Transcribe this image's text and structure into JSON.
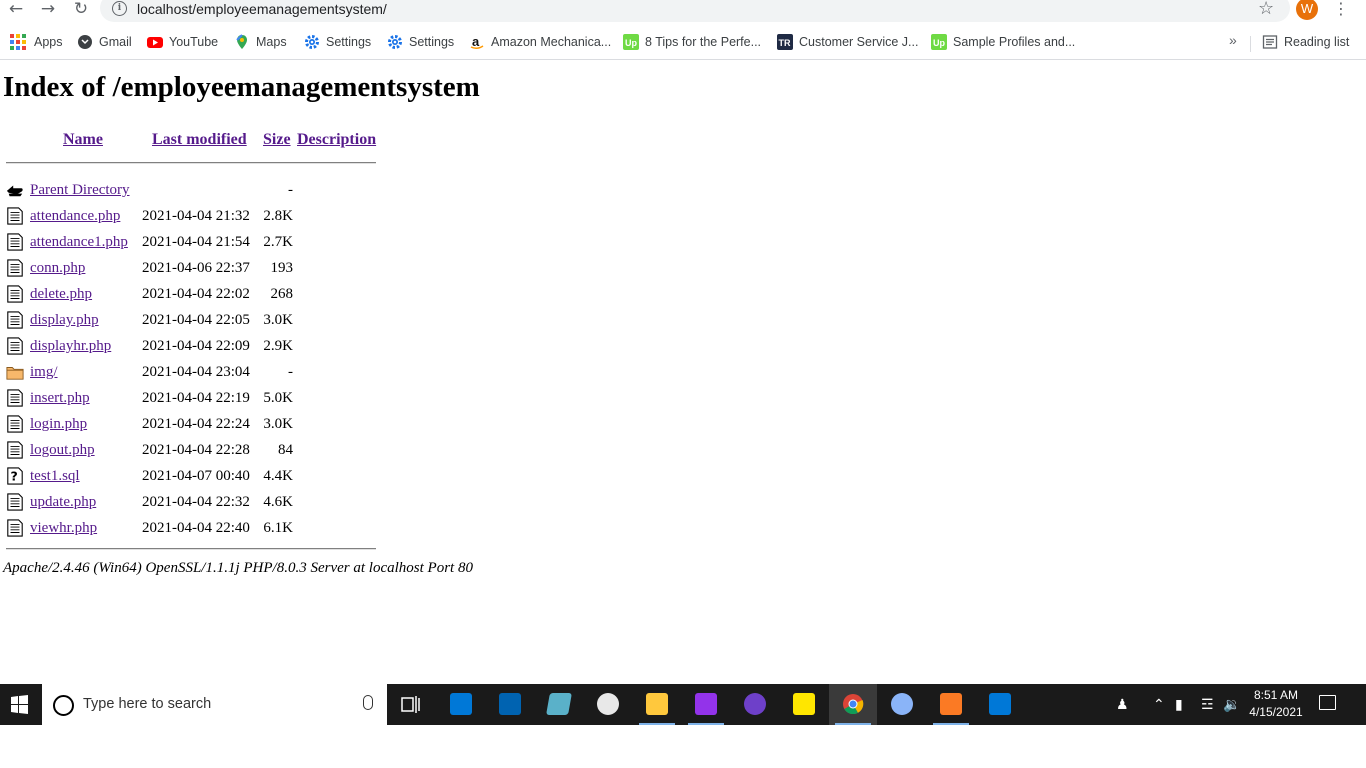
{
  "browser": {
    "url": "localhost/employeemanagementsystem/",
    "avatar_letter": "W",
    "bookmarks": [
      {
        "label": "Apps",
        "icon": "apps-grid-icon"
      },
      {
        "label": "Gmail",
        "icon": "gmail-icon"
      },
      {
        "label": "YouTube",
        "icon": "youtube-icon"
      },
      {
        "label": "Maps",
        "icon": "maps-icon"
      },
      {
        "label": "Settings",
        "icon": "settings-gear-icon"
      },
      {
        "label": "Settings",
        "icon": "settings-gear-icon"
      },
      {
        "label": "Amazon Mechanica...",
        "icon": "amazon-icon"
      },
      {
        "label": "8 Tips for the Perfe...",
        "icon": "upwork-icon"
      },
      {
        "label": "Customer Service J...",
        "icon": "tr-icon"
      },
      {
        "label": "Sample Profiles and...",
        "icon": "upwork-icon"
      }
    ],
    "more_bookmarks": "»",
    "reading_list": "Reading list"
  },
  "page": {
    "title": "Index of /employeemanagementsystem",
    "columns": {
      "name": "Name",
      "modified": "Last modified",
      "size": "Size",
      "description": "Description"
    },
    "parent": {
      "label": "Parent Directory",
      "size": "-"
    },
    "entries": [
      {
        "name": "attendance.php",
        "modified": "2021-04-04 21:32",
        "size": "2.8K",
        "type": "file"
      },
      {
        "name": "attendance1.php",
        "modified": "2021-04-04 21:54",
        "size": "2.7K",
        "type": "file"
      },
      {
        "name": "conn.php",
        "modified": "2021-04-06 22:37",
        "size": "193",
        "type": "file"
      },
      {
        "name": "delete.php",
        "modified": "2021-04-04 22:02",
        "size": "268",
        "type": "file"
      },
      {
        "name": "display.php",
        "modified": "2021-04-04 22:05",
        "size": "3.0K",
        "type": "file"
      },
      {
        "name": "displayhr.php",
        "modified": "2021-04-04 22:09",
        "size": "2.9K",
        "type": "file"
      },
      {
        "name": "img/",
        "modified": "2021-04-04 23:04",
        "size": "-",
        "type": "folder"
      },
      {
        "name": "insert.php",
        "modified": "2021-04-04 22:19",
        "size": "5.0K",
        "type": "file"
      },
      {
        "name": "login.php",
        "modified": "2021-04-04 22:24",
        "size": "3.0K",
        "type": "file"
      },
      {
        "name": "logout.php",
        "modified": "2021-04-04 22:28",
        "size": "84",
        "type": "file"
      },
      {
        "name": "test1.sql",
        "modified": "2021-04-07 00:40",
        "size": "4.4K",
        "type": "unknown"
      },
      {
        "name": "update.php",
        "modified": "2021-04-04 22:32",
        "size": "4.6K",
        "type": "file"
      },
      {
        "name": "viewhr.php",
        "modified": "2021-04-04 22:40",
        "size": "6.1K",
        "type": "file"
      }
    ],
    "footer": "Apache/2.4.46 (Win64) OpenSSL/1.1.1j PHP/8.0.3 Server at localhost Port 80"
  },
  "taskbar": {
    "search_placeholder": "Type here to search",
    "time": "8:51 AM",
    "date": "4/15/2021"
  },
  "colors": {
    "link": "#551a8b",
    "taskbar_bg": "#1a1a1a",
    "avatar": "#e8710a"
  }
}
